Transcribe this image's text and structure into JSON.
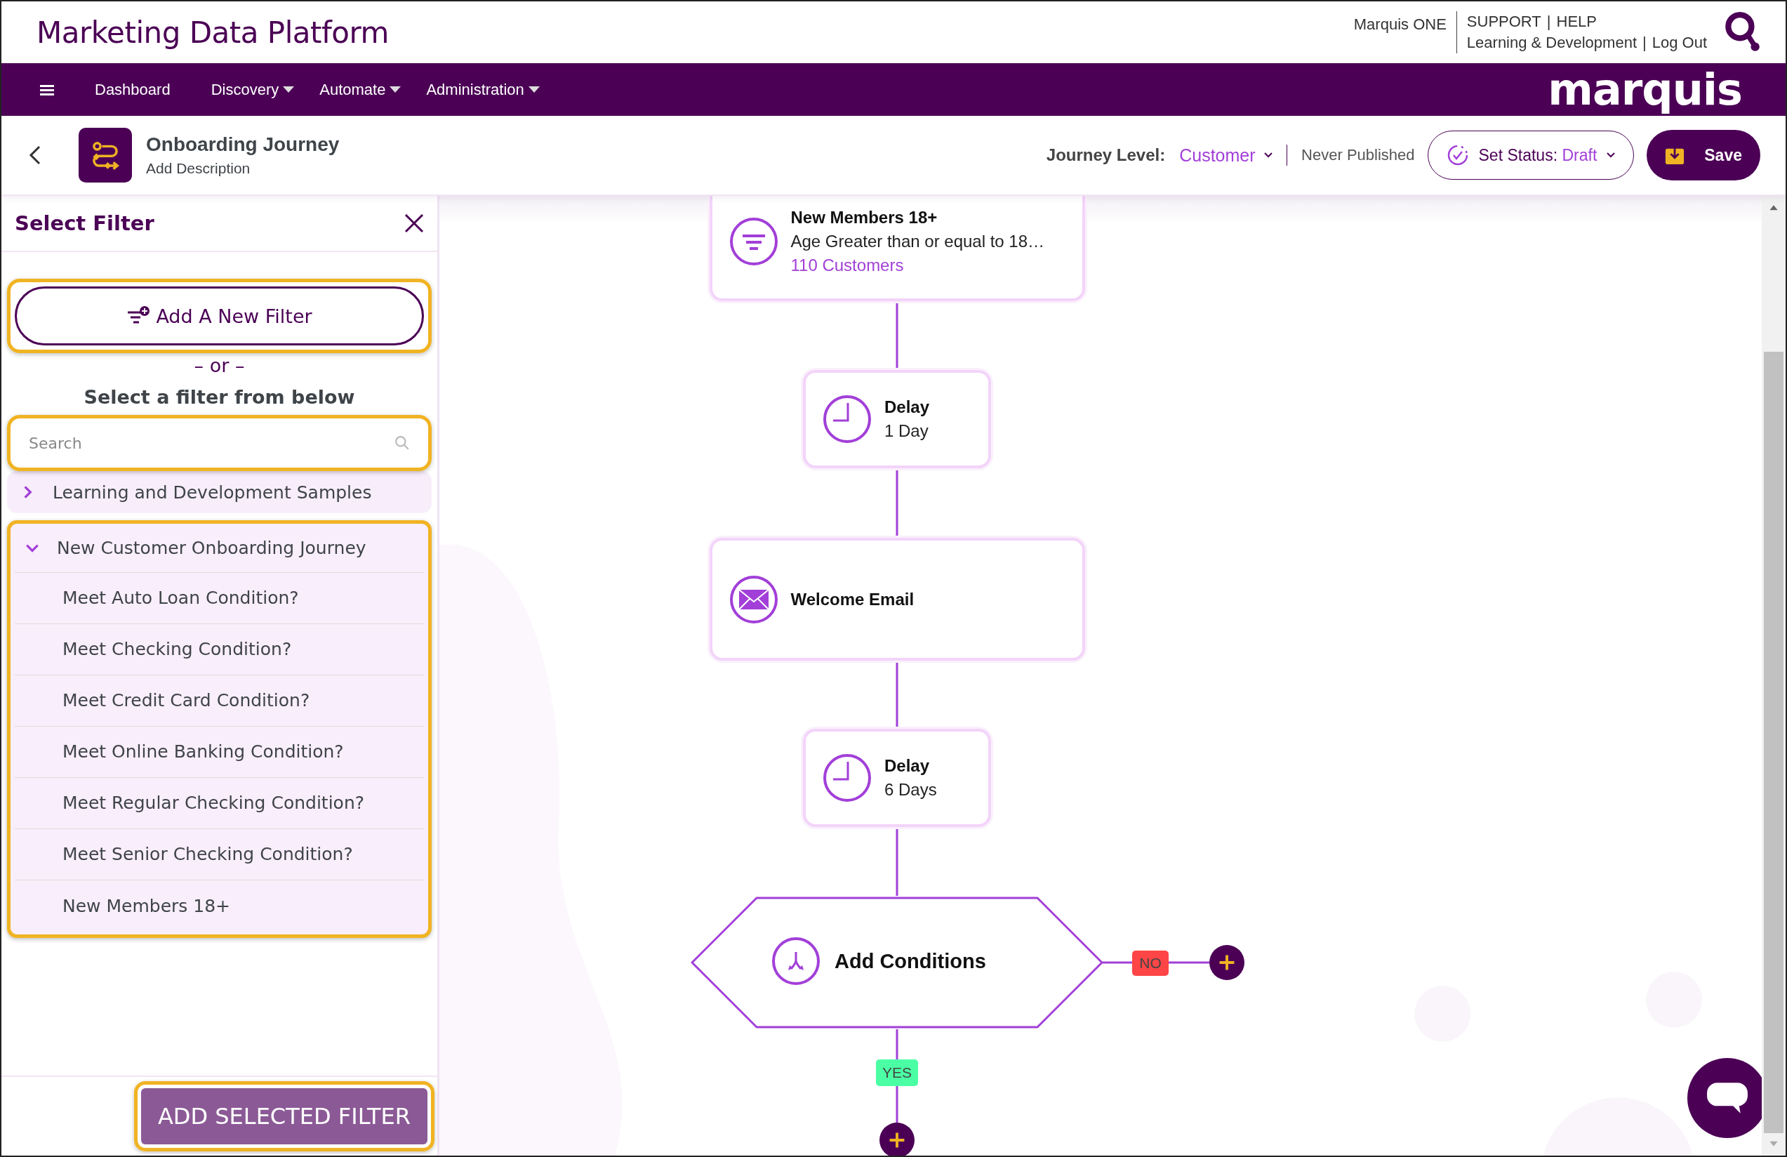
{
  "header": {
    "title": "Marketing Data Platform",
    "product_link": "Marquis ONE",
    "support_line": [
      "SUPPORT",
      "|",
      "HELP"
    ],
    "learning_line": [
      "Learning & Development",
      "|",
      "Log Out"
    ]
  },
  "nav": {
    "items": [
      {
        "label": "Dashboard",
        "dropdown": false
      },
      {
        "label": "Discovery",
        "dropdown": true
      },
      {
        "label": "Automate",
        "dropdown": true
      },
      {
        "label": "Administration",
        "dropdown": true
      }
    ],
    "logo": "marquis"
  },
  "journey": {
    "title": "Onboarding Journey",
    "description": "Add Description",
    "level_label": "Journey Level:",
    "level_value": "Customer",
    "publish_state": "Never Published",
    "status_label": "Set Status:",
    "status_value": "Draft",
    "save": "Save"
  },
  "filter_panel": {
    "title": "Select Filter",
    "add_button": {
      "label": "Add A New Filter",
      "highlighted": true
    },
    "or_text": "– or –",
    "heading": "Select a filter from below",
    "search": {
      "placeholder": "Search",
      "highlighted": true
    },
    "tree": [
      {
        "label": "Learning and Development Samples",
        "expanded": false,
        "highlighted": false
      },
      {
        "label": "New Customer Onboarding Journey",
        "expanded": true,
        "highlighted": true,
        "children": [
          {
            "label": "Meet Auto Loan Condition?"
          },
          {
            "label": "Meet Checking Condition?"
          },
          {
            "label": "Meet Credit Card Condition?"
          },
          {
            "label": "Meet Online Banking Condition?"
          },
          {
            "label": "Meet Regular Checking Condition?"
          },
          {
            "label": "Meet Senior Checking Condition?"
          },
          {
            "label": "New Members 18+"
          }
        ]
      }
    ],
    "add_selected_button": {
      "label": "ADD SELECTED FILTER",
      "highlighted": true
    }
  },
  "flow": {
    "nodes": [
      {
        "kind": "filter",
        "title": "New Members 18+",
        "subtitle": "Age Greater than or equal to 18…",
        "count": "110 Customers"
      },
      {
        "kind": "delay",
        "title": "Delay",
        "value": "1 Day"
      },
      {
        "kind": "email",
        "title": "Welcome Email"
      },
      {
        "kind": "delay",
        "title": "Delay",
        "value": "6 Days"
      },
      {
        "kind": "condition",
        "title": "Add Conditions"
      }
    ],
    "no_label": "NO",
    "yes_label": "YES"
  }
}
